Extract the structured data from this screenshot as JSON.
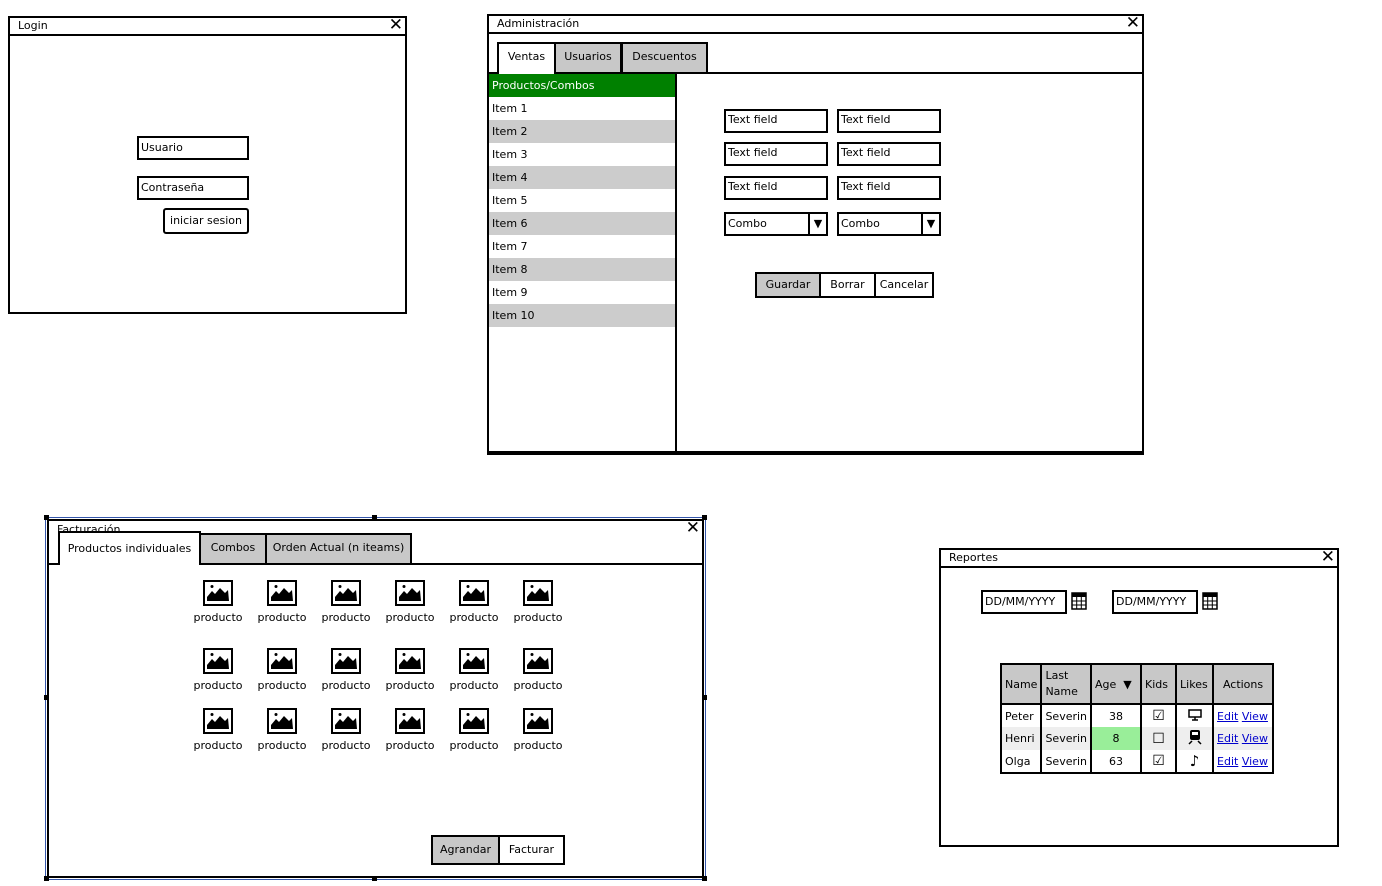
{
  "login": {
    "title": "Login",
    "username_placeholder": "Usuario",
    "password_placeholder": "Contraseña",
    "login_button": "iniciar sesion"
  },
  "admin": {
    "title": "Administración",
    "tabs": [
      {
        "label": "Ventas",
        "active": true
      },
      {
        "label": "Usuarios",
        "active": false
      },
      {
        "label": "Descuentos",
        "active": false
      }
    ],
    "list_items": [
      "Productos/Combos",
      "Item 1",
      "Item 2",
      "Item 3",
      "Item 4",
      "Item 5",
      "Item 6",
      "Item 7",
      "Item 8",
      "Item 9",
      "Item 10"
    ],
    "selected_index": 0,
    "text_fields": [
      "Text field",
      "Text field",
      "Text field",
      "Text field",
      "Text field",
      "Text field"
    ],
    "combos": [
      "Combo",
      "Combo"
    ],
    "buttons": {
      "save": "Guardar",
      "clear": "Borrar",
      "cancel": "Cancelar"
    }
  },
  "billing": {
    "title": "Facturación",
    "tabs": [
      {
        "label": "Productos individuales",
        "active": true
      },
      {
        "label": "Combos",
        "active": false
      },
      {
        "label": "Orden Actual (n iteams)",
        "active": false
      }
    ],
    "product_label": "producto",
    "buttons": {
      "add": "Agrandar",
      "invoice": "Facturar"
    }
  },
  "reports": {
    "title": "Reportes",
    "date_placeholder": "DD/MM/YYYY",
    "table": {
      "headers": [
        "Name",
        "Last Name",
        "Age",
        "Kids",
        "Likes",
        "Actions"
      ],
      "rows": [
        {
          "name": "Peter",
          "last": "Severin",
          "age": "38",
          "kids": true,
          "likes": "monitor-icon"
        },
        {
          "name": "Henri",
          "last": "Severin",
          "age": "8",
          "kids": false,
          "likes": "train-icon"
        },
        {
          "name": "Olga",
          "last": "Severin",
          "age": "63",
          "kids": true,
          "likes": "music-note-icon"
        }
      ],
      "actions": [
        "Edit",
        "View"
      ]
    },
    "highlight_color": "#99ee99"
  },
  "colors": {
    "selected_list": "#008000",
    "inactive_tab": "#c8c8c8",
    "link": "#0000cc",
    "selection_frame": "#3355aa"
  }
}
